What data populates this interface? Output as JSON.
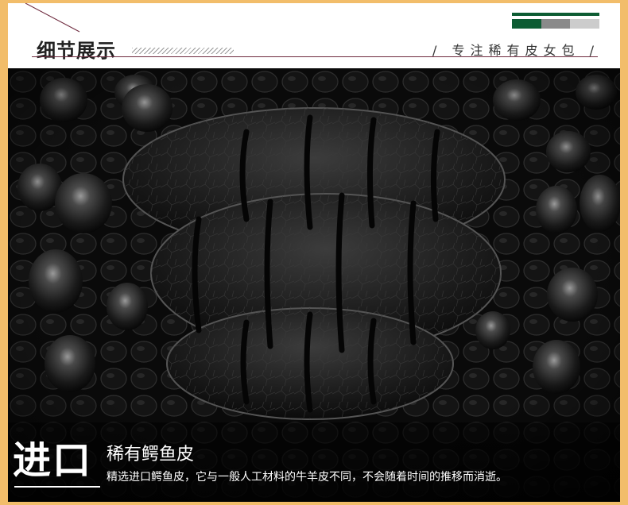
{
  "header": {
    "title": "细节展示",
    "slogan": "/ 专注稀有皮女包 /",
    "accent_color": "#6e2a3e",
    "color_bar": [
      "#0d5c33",
      "#8a8a8a",
      "#cccccc"
    ]
  },
  "photo": {
    "subject": "crocodile-leather-texture-image"
  },
  "caption": {
    "badge": "进口",
    "subtitle": "稀有鳄鱼皮",
    "description": "精选进口鳄鱼皮，它与一般人工材料的牛羊皮不同，不会随着时间的推移而消逝。"
  },
  "frame_color": "#f2bd6a"
}
